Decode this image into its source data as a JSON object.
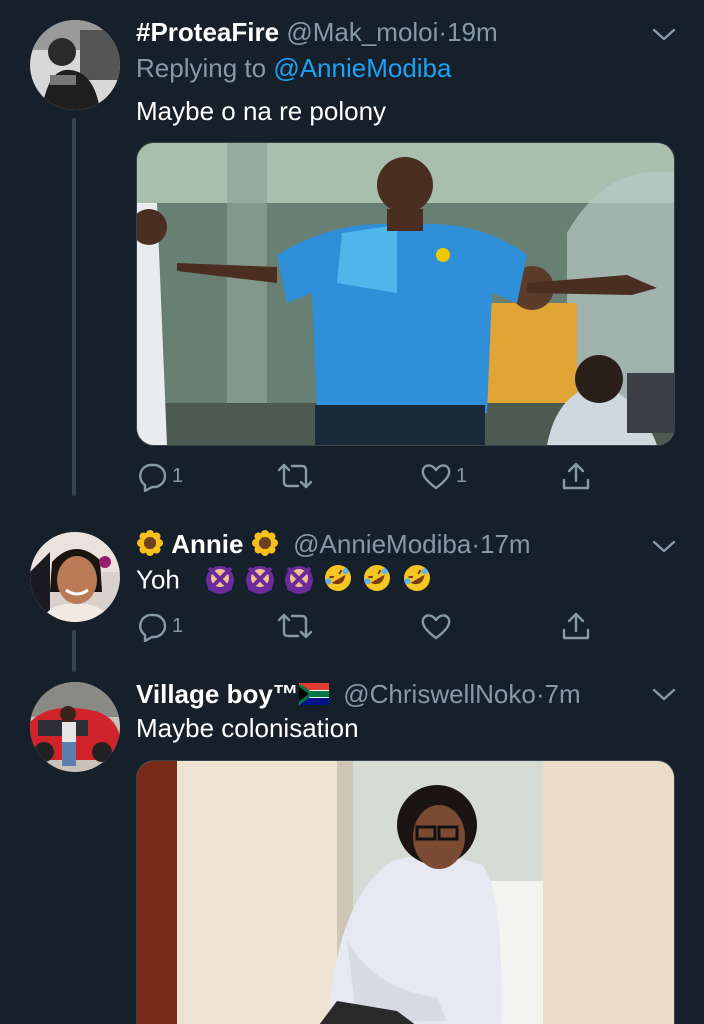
{
  "tweets": [
    {
      "name": "#ProteaFire",
      "handle": "@Mak_moloi",
      "time": "19m",
      "replying_prefix": "Replying to",
      "replying_to": "@AnnieModiba",
      "text": "Maybe o na re polony",
      "media": "photo: coach in blue polo shirt with arms spread on a football field",
      "actions": {
        "reply_count": "1",
        "retweet_count": "",
        "like_count": "1"
      }
    },
    {
      "name": "Annie",
      "handle": "@AnnieModiba",
      "time": "17m",
      "text": "Yoh",
      "actions": {
        "reply_count": "1",
        "retweet_count": "",
        "like_count": ""
      }
    },
    {
      "name": "Village boy™",
      "handle": "@ChriswellNoko",
      "time": "7m",
      "text": "Maybe colonisation",
      "media": "photo: woman in white shirt and glasses standing by a door"
    }
  ],
  "separator": "·",
  "icons": {
    "reply": "reply-icon",
    "retweet": "retweet-icon",
    "like": "heart-icon",
    "share": "share-icon",
    "more": "chevron-down-icon"
  },
  "colors": {
    "background": "#15202b",
    "secondary_text": "#8899a6",
    "link": "#1da1f2",
    "thread_line": "#38444d"
  }
}
